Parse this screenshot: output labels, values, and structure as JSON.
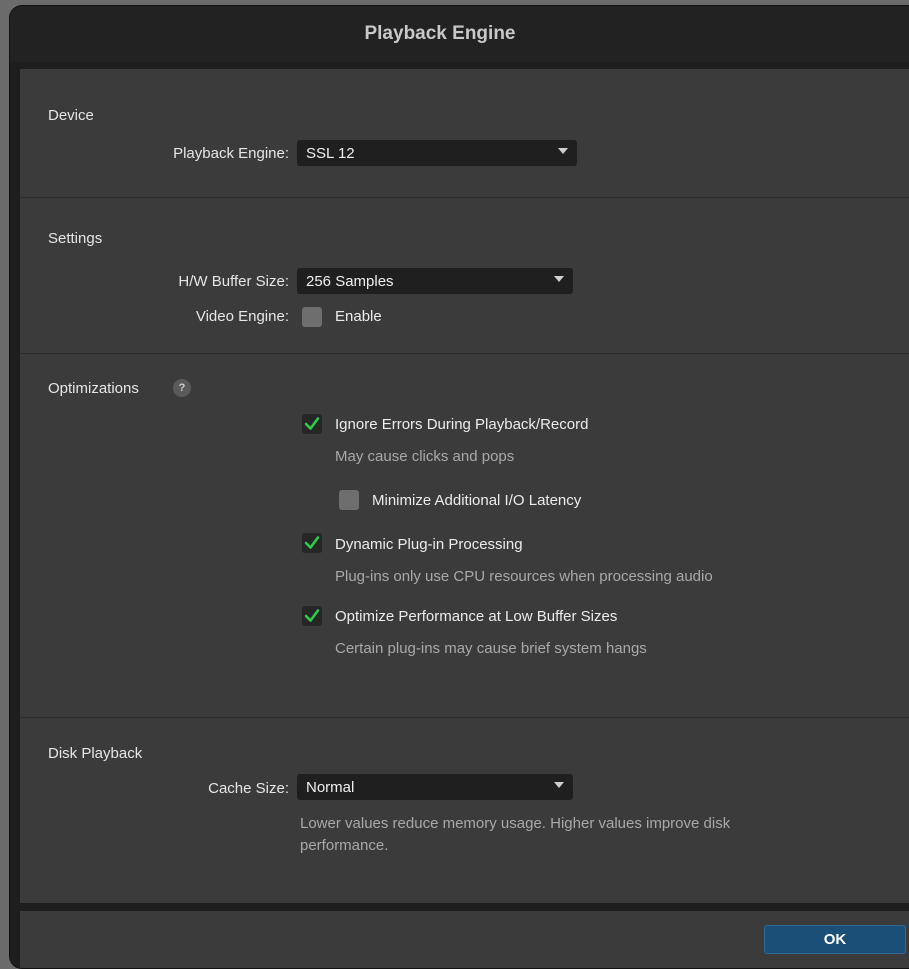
{
  "window": {
    "title": "Playback Engine"
  },
  "device": {
    "section_title": "Device",
    "playback_engine_label": "Playback Engine:",
    "playback_engine_value": "SSL 12"
  },
  "settings": {
    "section_title": "Settings",
    "buffer_size_label": "H/W Buffer Size:",
    "buffer_size_value": "256 Samples",
    "video_engine_label": "Video Engine:",
    "video_engine_option": "Enable",
    "video_engine_enabled": false
  },
  "optimizations": {
    "section_title": "Optimizations",
    "help_glyph": "?",
    "items": [
      {
        "label": "Ignore Errors During Playback/Record",
        "description": "May cause clicks and pops",
        "checked": true
      },
      {
        "label": "Minimize Additional I/O Latency",
        "description": "",
        "checked": false
      },
      {
        "label": "Dynamic Plug-in Processing",
        "description": "Plug-ins only use CPU resources when processing audio",
        "checked": true
      },
      {
        "label": "Optimize Performance at Low Buffer Sizes",
        "description": "Certain plug-ins may cause brief system hangs",
        "checked": true
      }
    ]
  },
  "disk_playback": {
    "section_title": "Disk Playback",
    "cache_size_label": "Cache Size:",
    "cache_size_value": "Normal",
    "cache_description_line1": "Lower values reduce memory usage. Higher values improve disk",
    "cache_description_line2": "performance."
  },
  "footer": {
    "ok_label": "OK"
  },
  "colors": {
    "check_green": "#2ecc4a",
    "ok_button": "#1c4f78",
    "panel": "#3b3b3b",
    "titlebar": "#222222"
  }
}
